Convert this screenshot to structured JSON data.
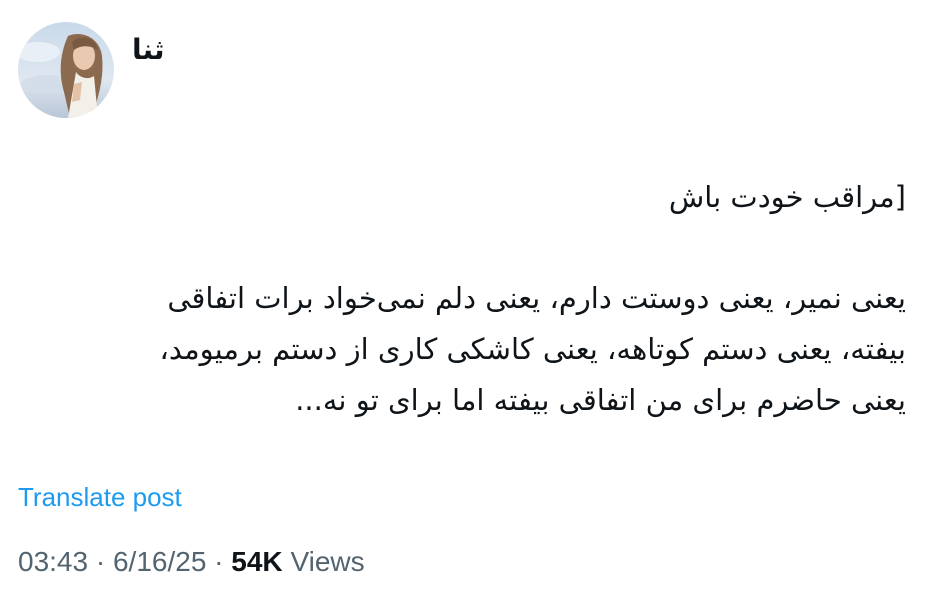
{
  "author": {
    "display_name": "ثنا"
  },
  "post": {
    "title_line": "[مراقب خودت باش",
    "body_lines": [
      "یعنی نمیر، یعنی دوستت دارم، یعنی دلم نمی‌خواد برات اتفاقی",
      "بیفته، یعنی دستم کوتاهه، یعنی کاشکی کاری از دستم برمیومد،",
      "یعنی حاضرم برای من اتفاقی بیفته اما برای تو نه..."
    ]
  },
  "translate_label": "Translate post",
  "meta": {
    "time": "03:43",
    "separator": "·",
    "date": "6/16/25",
    "views_count": "54K",
    "views_label": "Views"
  },
  "colors": {
    "text": "#0f1419",
    "secondary": "#536471",
    "link": "#1d9bf0"
  },
  "icons": {
    "avatar": "profile-photo"
  }
}
